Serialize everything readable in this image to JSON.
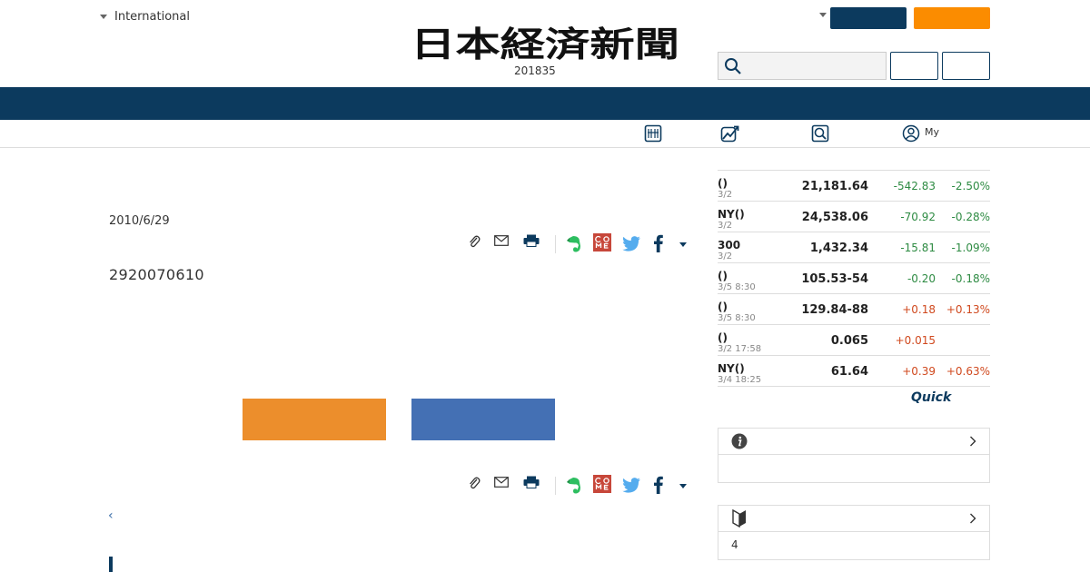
{
  "header": {
    "edition_label": "International",
    "edition_number": "201835",
    "logo_text": "日本経済新聞"
  },
  "article": {
    "date": "2010/6/29",
    "body": "2920070610",
    "back_label": "‹"
  },
  "markets": [
    {
      "name": "()",
      "time": "3/2",
      "value": "21,181.64",
      "change": "-542.83",
      "pct": "-2.50%",
      "dir": "down"
    },
    {
      "name": "NY()",
      "time": "3/2",
      "value": "24,538.06",
      "change": "-70.92",
      "pct": "-0.28%",
      "dir": "down"
    },
    {
      "name": "300",
      "time": "3/2",
      "value": "1,432.34",
      "change": "-15.81",
      "pct": "-1.09%",
      "dir": "down"
    },
    {
      "name": "()",
      "time": "3/5 8:30",
      "value": "105.53-54",
      "change": "-0.20",
      "pct": "-0.18%",
      "dir": "down"
    },
    {
      "name": "()",
      "time": "3/5 8:30",
      "value": "129.84-88",
      "change": "+0.18",
      "pct": "+0.13%",
      "dir": "up"
    },
    {
      "name": "()",
      "time": "3/2 17:58",
      "value": "0.065",
      "change": "+0.015",
      "pct": "",
      "dir": "up"
    },
    {
      "name": "NY()",
      "time": "3/4 18:25",
      "value": "61.64",
      "change": "+0.39",
      "pct": "+0.63%",
      "dir": "up"
    }
  ],
  "quick_logo": "Quick",
  "subnav": {
    "my_label": "My"
  },
  "side_box_2": {
    "text": "4"
  },
  "colors": {
    "navy": "#0c3a5e",
    "orange": "#fb8c00",
    "cta_orange": "#ec8e2c",
    "cta_blue": "#4470b4",
    "down": "#2e8b43",
    "up": "#d0491e"
  }
}
